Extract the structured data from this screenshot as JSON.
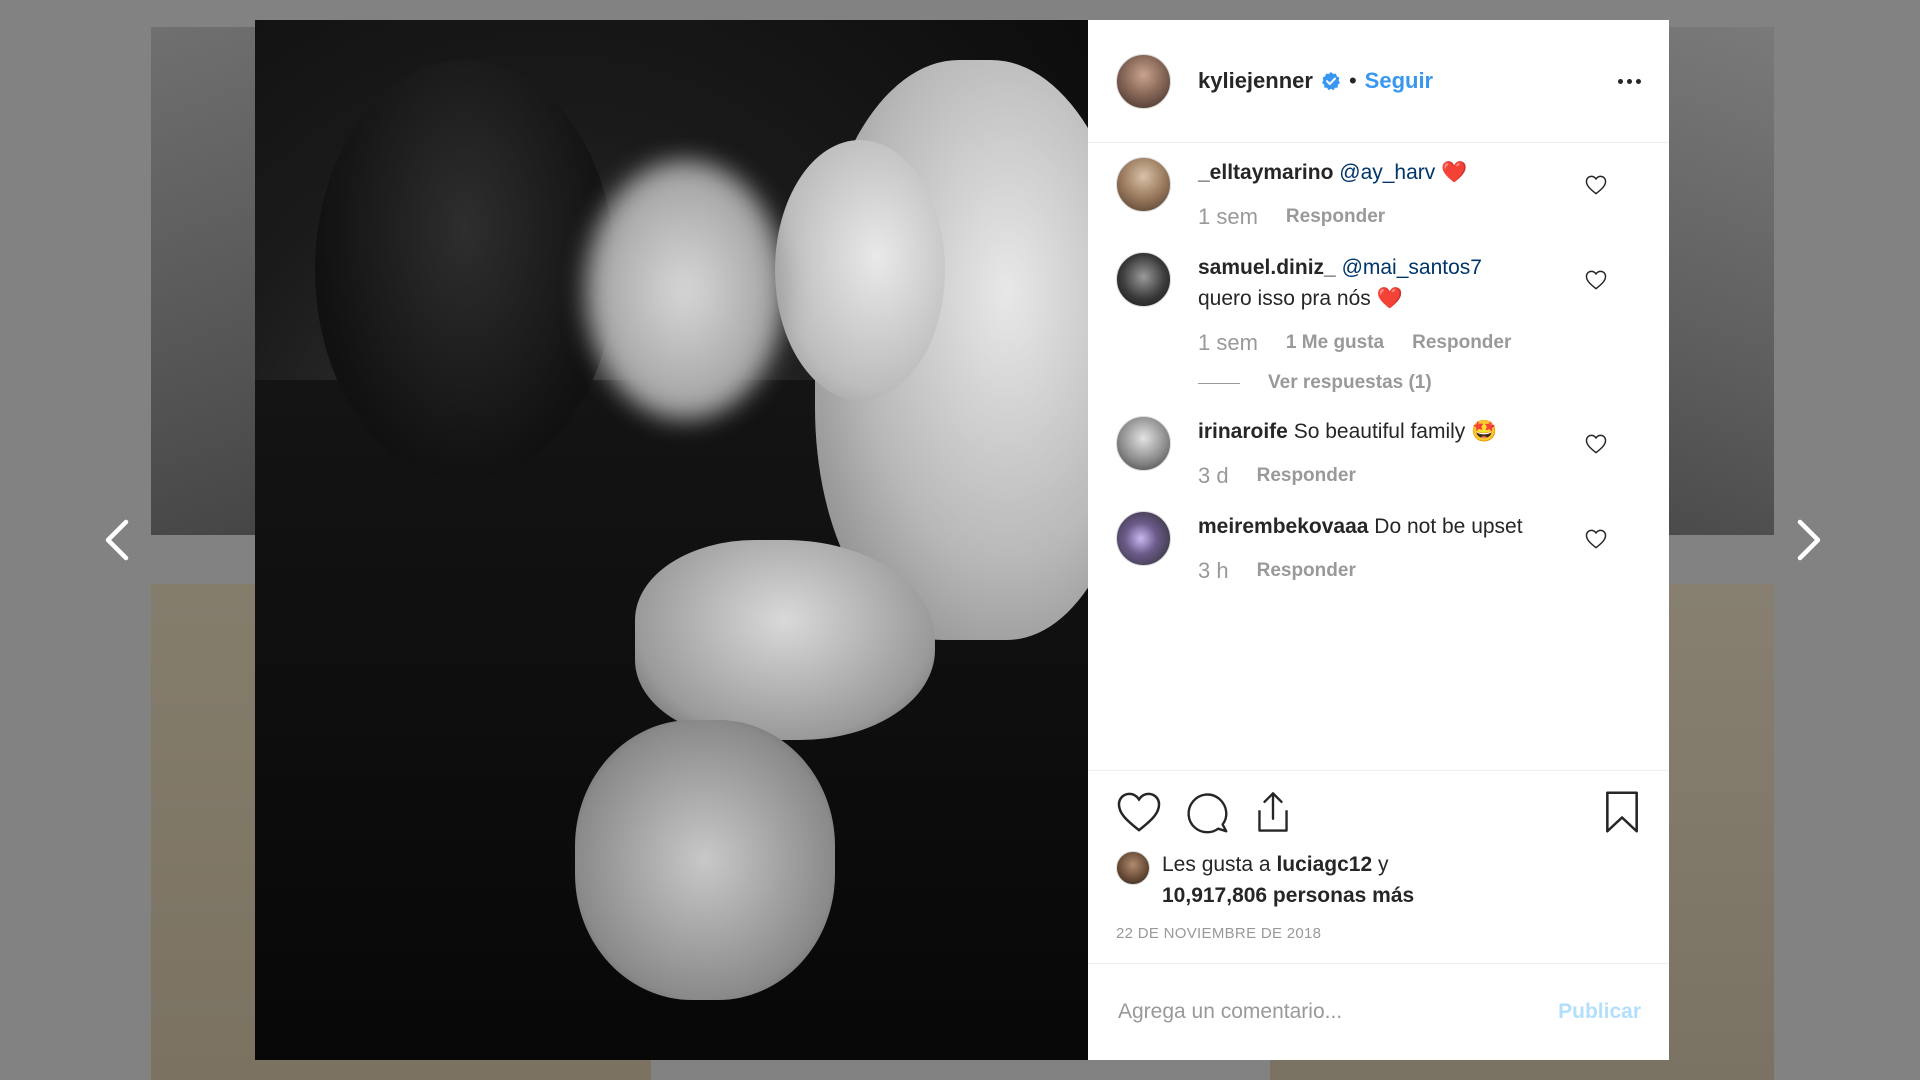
{
  "post": {
    "username": "kyliejenner",
    "verified": true,
    "separator": "•",
    "follow_label": "Seguir",
    "more_icon": "more-options-icon",
    "image_alt": "Family photo, black and white"
  },
  "comments": [
    {
      "username": "_elltaymarino",
      "mention": "@ay_harv",
      "text": "",
      "emoji": "❤️",
      "time": "1 sem",
      "likes": "",
      "reply_label": "Responder"
    },
    {
      "username": "samuel.diniz_",
      "mention": "@mai_santos7",
      "text": "quero isso pra nós",
      "emoji": "❤️",
      "time": "1 sem",
      "likes": "1 Me gusta",
      "reply_label": "Responder",
      "view_replies": "Ver respuestas (1)"
    },
    {
      "username": "irinaroife",
      "mention": "",
      "text": "So beautiful family",
      "emoji": "🤩",
      "time": "3 d",
      "likes": "",
      "reply_label": "Responder"
    },
    {
      "username": "meirembekovaaa",
      "mention": "",
      "text": "Do not be upset",
      "emoji": "",
      "time": "3 h",
      "likes": "",
      "reply_label": "Responder"
    }
  ],
  "actions": {
    "like_icon": "heart-icon",
    "comment_icon": "comment-icon",
    "share_icon": "share-icon",
    "save_icon": "bookmark-icon"
  },
  "likes": {
    "prefix": "Les gusta a",
    "liked_by": "luciagc12",
    "conjunction": "y",
    "others": "10,917,806 personas más"
  },
  "date": "22 DE NOVIEMBRE DE 2018",
  "add_comment": {
    "placeholder": "Agrega un comentario...",
    "publish_label": "Publicar"
  },
  "colors": {
    "link_blue": "#3897f0",
    "mention_blue": "#003569",
    "muted_text": "#999999",
    "publish_disabled": "#b2dffc",
    "heart_red": "#ed4956",
    "overlay": "#828282"
  }
}
